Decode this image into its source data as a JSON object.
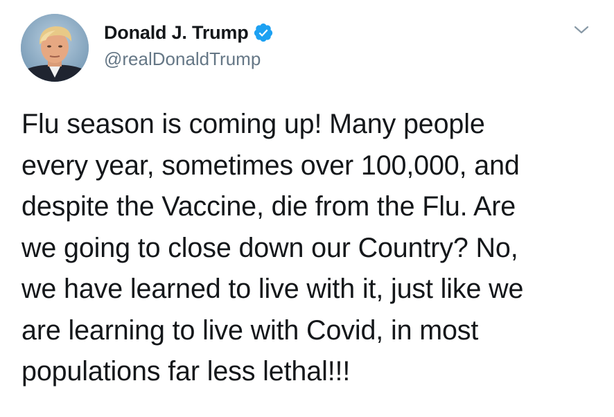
{
  "author": {
    "name": "Donald J. Trump",
    "handle": "@realDonaldTrump",
    "verified": true,
    "avatar_icon": "profile-photo"
  },
  "tweet": {
    "text_lines": [
      "Flu season is coming up! Many people",
      "every year, sometimes over 100,000, and",
      "despite the Vaccine, die from the Flu. Are",
      "we going to close down our Country? No,",
      "we have learned to live with it, just like we",
      "are learning to live with Covid, in most",
      "populations far less lethal!!!"
    ]
  },
  "icons": {
    "verified": "verified-badge-icon",
    "menu": "chevron-down-icon"
  },
  "colors": {
    "text": "#14171a",
    "secondary": "#657786",
    "verified_blue": "#1da1f2"
  }
}
